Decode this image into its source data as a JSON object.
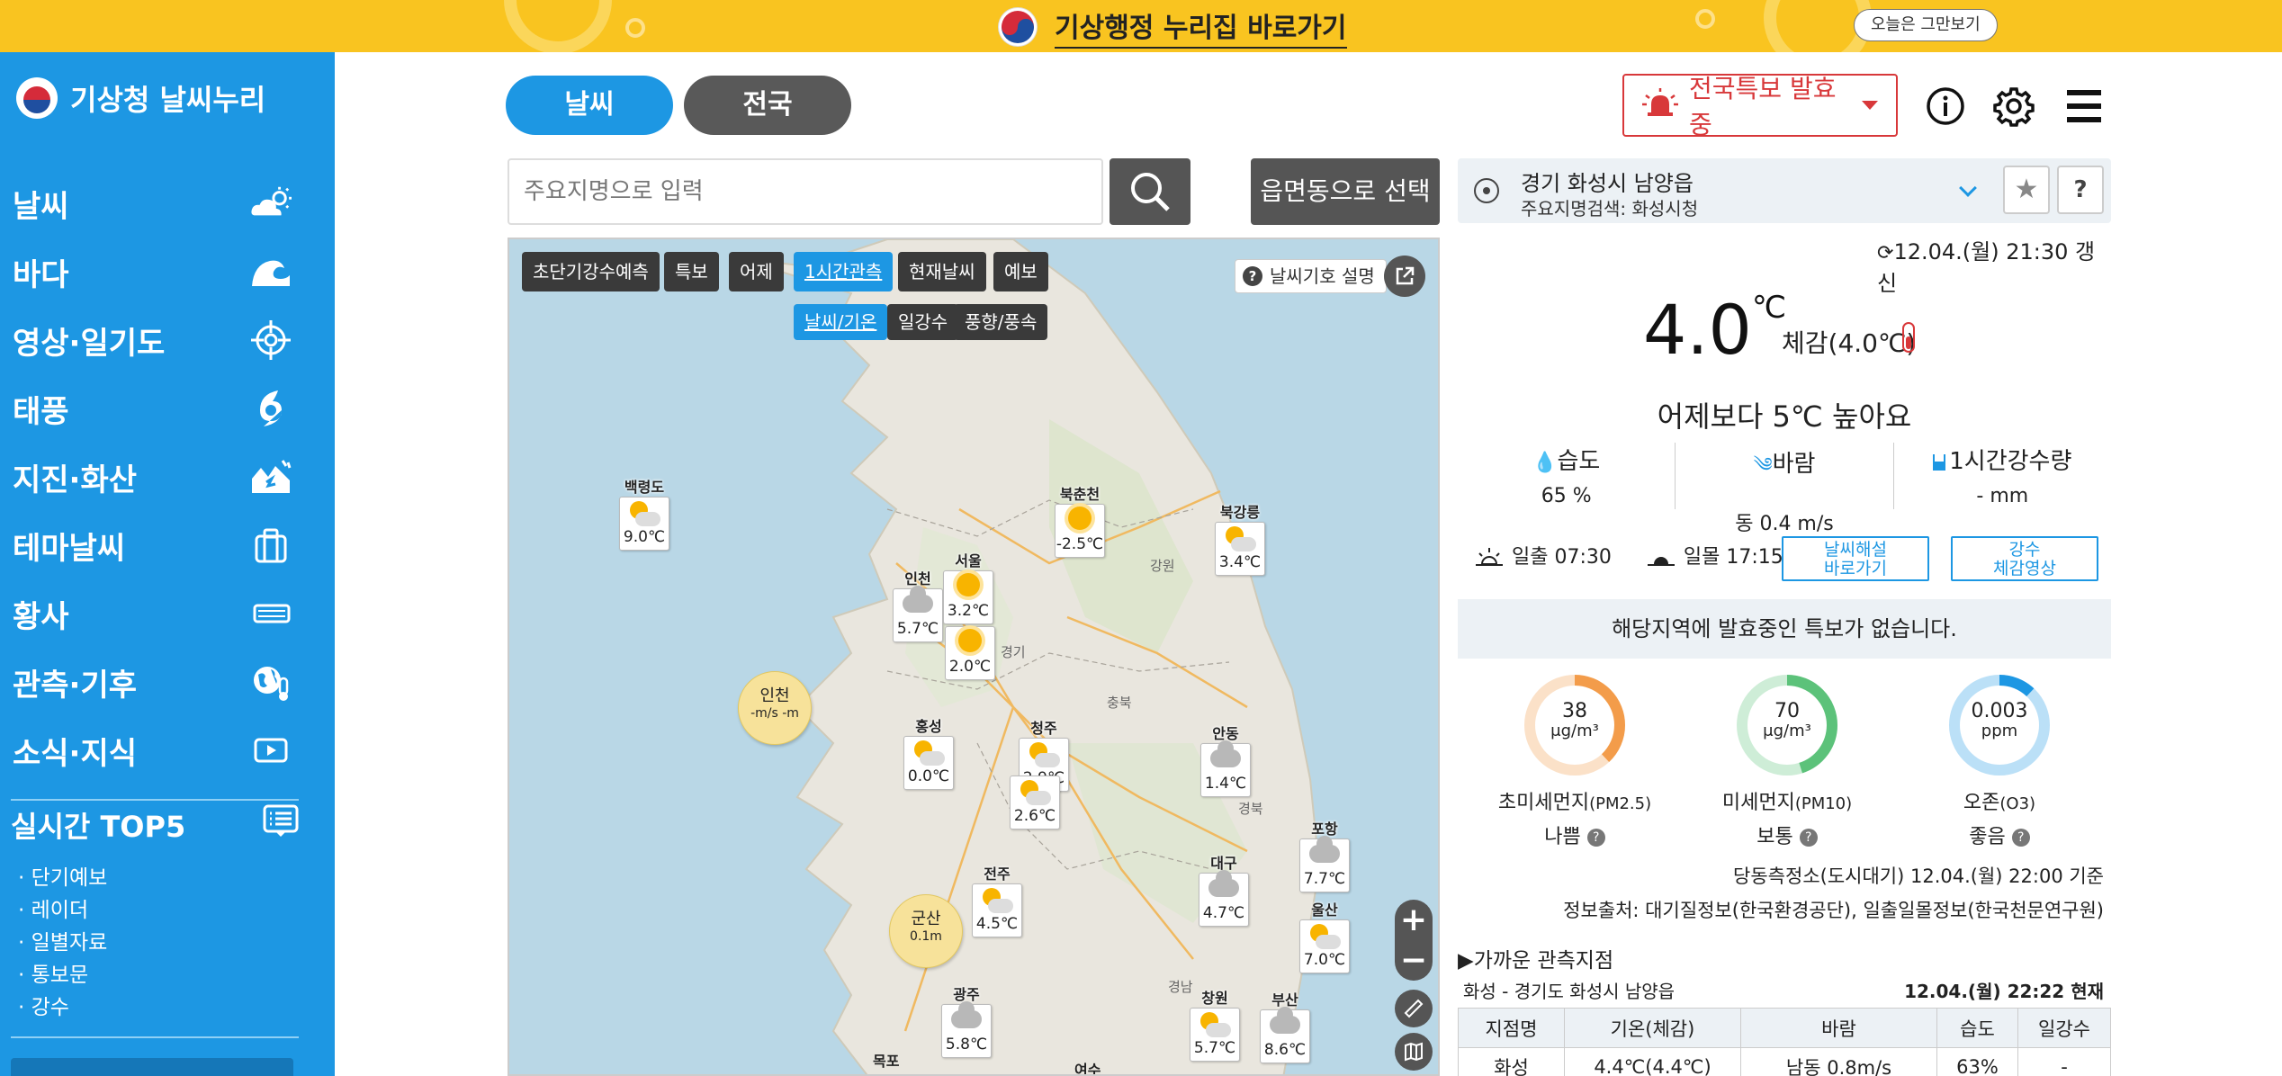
{
  "banner": {
    "title": "기상행정 누리집 바로가기",
    "dismiss": "오늘은 그만보기"
  },
  "sidebar": {
    "logo": "기상청 날씨누리",
    "items": [
      {
        "label": "날씨",
        "icon": "weather-icon"
      },
      {
        "label": "바다",
        "icon": "wave-icon"
      },
      {
        "label": "영상·일기도",
        "icon": "satellite-target-icon"
      },
      {
        "label": "태풍",
        "icon": "typhoon-icon"
      },
      {
        "label": "지진·화산",
        "icon": "earthquake-icon"
      },
      {
        "label": "테마날씨",
        "icon": "briefcase-icon"
      },
      {
        "label": "황사",
        "icon": "dust-icon"
      },
      {
        "label": "관측·기후",
        "icon": "globe-thermometer-icon"
      },
      {
        "label": "소식·지식",
        "icon": "video-icon"
      }
    ],
    "top5_title": "실시간 TOP5",
    "top5": [
      "단기예보",
      "레이더",
      "일별자료",
      "통보문",
      "강수"
    ]
  },
  "tabs": [
    "날씨",
    "전국"
  ],
  "alert_button": "전국특보 발효중",
  "search": {
    "placeholder": "주요지명으로 입력",
    "select_label": "읍면동으로 선택"
  },
  "map": {
    "chips_row1": [
      "초단기강수예측",
      "특보",
      "어제",
      "1시간관측",
      "현재날씨",
      "예보"
    ],
    "active_chip": "1시간관측",
    "chips_row2": [
      "날씨/기온",
      "일강수",
      "풍향/풍속"
    ],
    "active_chip2": "날씨/기온",
    "legend_label": "날씨기호 설명",
    "region_labels": [
      "강원",
      "경기",
      "충북",
      "경북",
      "경남"
    ],
    "stations": [
      {
        "name": "백령도",
        "temp": "9.0℃",
        "icon": "partly-sunny"
      },
      {
        "name": "북춘천",
        "temp": "-2.5℃",
        "icon": "sunny"
      },
      {
        "name": "북강릉",
        "temp": "3.4℃",
        "icon": "partly-sunny"
      },
      {
        "name": "인천",
        "temp": "5.7℃",
        "icon": "cloudy"
      },
      {
        "name": "서울",
        "temp": "3.2℃",
        "icon": "sunny"
      },
      {
        "name": "",
        "temp": "2.0℃",
        "icon": "sunny"
      },
      {
        "name": "홍성",
        "temp": "0.0℃",
        "icon": "partly-sunny"
      },
      {
        "name": "청주",
        "temp": "2.9℃",
        "icon": "partly-sunny"
      },
      {
        "name": "",
        "temp": "2.6℃",
        "icon": "partly-sunny"
      },
      {
        "name": "안동",
        "temp": "1.4℃",
        "icon": "cloudy"
      },
      {
        "name": "포항",
        "temp": "7.7℃",
        "icon": "cloudy"
      },
      {
        "name": "대구",
        "temp": "4.7℃",
        "icon": "cloudy"
      },
      {
        "name": "전주",
        "temp": "4.5℃",
        "icon": "partly-sunny"
      },
      {
        "name": "울산",
        "temp": "7.0℃",
        "icon": "partly-sunny"
      },
      {
        "name": "광주",
        "temp": "5.8℃",
        "icon": "cloudy"
      },
      {
        "name": "창원",
        "temp": "5.7℃",
        "icon": "partly-sunny"
      },
      {
        "name": "부산",
        "temp": "8.6℃",
        "icon": "cloudy"
      }
    ],
    "sea_stations": [
      {
        "name": "인천",
        "value": "-m/s -m"
      },
      {
        "name": "군산",
        "value": "0.1m"
      }
    ],
    "partial_labels": [
      "목포",
      "여수"
    ]
  },
  "location": {
    "name": "경기 화성시 남양읍",
    "sub": "주요지명검색: 화성시청"
  },
  "updated": "12.04.(월) 21:30 갱신",
  "current": {
    "temp": "4.0",
    "unit": "℃",
    "feels": "체감(4.0℃)",
    "compare": "어제보다 5℃ 높아요",
    "humidity_label": "습도",
    "humidity": "65 %",
    "wind_label": "바람",
    "wind": "동 0.4 m/s",
    "rain_label": "1시간강수량",
    "rain": "- mm",
    "sunrise": "일출  07:30",
    "sunset": "일몰  17:15",
    "btn_explain": "날씨해설\n바로가기",
    "btn_video": "강수\n체감영상"
  },
  "no_warning": "해당지역에 발효중인 특보가 없습니다.",
  "air": [
    {
      "value": "38",
      "unit": "μg/m³",
      "label": "초미세먼지",
      "sub": "(PM2.5)",
      "grade": "나쁨",
      "color": "#f39c4a",
      "fraction": 0.38
    },
    {
      "value": "70",
      "unit": "μg/m³",
      "label": "미세먼지",
      "sub": "(PM10)",
      "grade": "보통",
      "color": "#5cc27a",
      "fraction": 0.45
    },
    {
      "value": "0.003",
      "unit": "ppm",
      "label": "오존",
      "sub": "(O3)",
      "grade": "좋음",
      "color": "#1d97e3",
      "fraction": 0.12
    }
  ],
  "air_source_1": "당동측정소(도시대기) 12.04.(월) 22:00 기준",
  "air_source_2": "정보출처: 대기질정보(한국환경공단), 일출일몰정보(한국천문연구원)",
  "near": {
    "title": "▶가까운 관측지점",
    "subtitle": "화성 - 경기도 화성시 남양읍",
    "time": "12.04.(월) 22:22 현재",
    "headers": [
      "지점명",
      "기온(체감)",
      "바람",
      "습도",
      "일강수"
    ],
    "row": [
      "화성",
      "4.4℃(4.4℃)",
      "남동 0.8m/s",
      "63%",
      "-"
    ]
  }
}
